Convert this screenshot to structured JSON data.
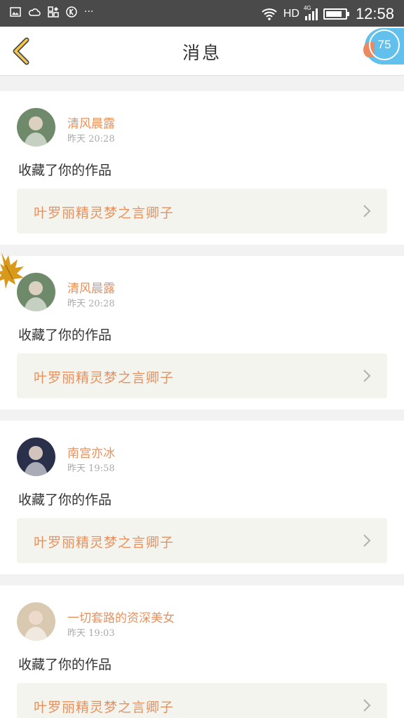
{
  "status_bar": {
    "network": "HD",
    "signal_label": "4G",
    "time": "12:58",
    "battery_level": 0.85
  },
  "header": {
    "title": "消息",
    "back_icon": "chevron-left-icon",
    "badge_text": "75"
  },
  "messages": [
    {
      "user": "清风晨露",
      "time": "昨天 20:28",
      "action": "收藏了你的作品",
      "work": "叶罗丽精灵梦之言卿子",
      "avatar_color": "#6f8a6a"
    },
    {
      "user": "清风晨露",
      "time": "昨天 20:28",
      "action": "收藏了你的作品",
      "work": "叶罗丽精灵梦之言卿子",
      "avatar_color": "#6f8a6a"
    },
    {
      "user": "南宫亦冰",
      "time": "昨天 19:58",
      "action": "收藏了你的作品",
      "work": "叶罗丽精灵梦之言卿子",
      "avatar_color": "#2a2f4a"
    },
    {
      "user": "一切套路的资深美女",
      "time": "昨天 19:03",
      "action": "收藏了你的作品",
      "work": "叶罗丽精灵梦之言卿子",
      "avatar_color": "#d9c9b0"
    }
  ],
  "colors": {
    "accent": "#e8915e",
    "badge": "#62c0ec",
    "back_arrow": "#f5c84a"
  }
}
